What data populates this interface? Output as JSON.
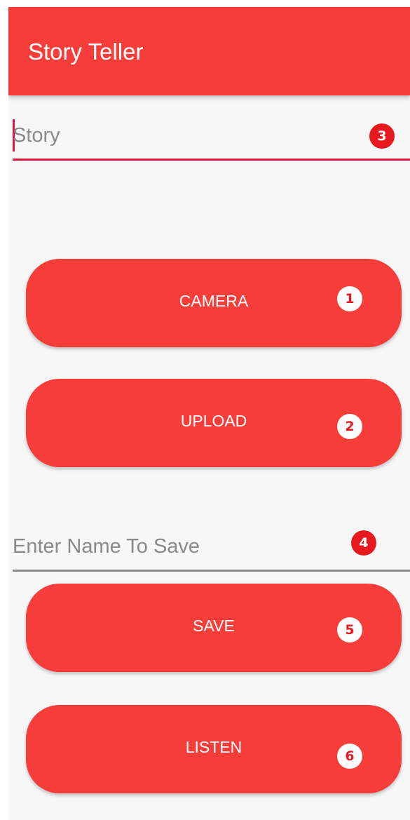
{
  "appbar": {
    "title": "Story Teller"
  },
  "story_field": {
    "placeholder": "Story",
    "badge": "3"
  },
  "buttons": [
    {
      "label": "CAMERA",
      "badge": "1"
    },
    {
      "label": "UPLOAD",
      "badge": "2"
    },
    {
      "label": "SAVE",
      "badge": "5"
    },
    {
      "label": "LISTEN",
      "badge": "6"
    }
  ],
  "name_field": {
    "placeholder": "Enter Name To Save",
    "badge": "4"
  },
  "colors": {
    "primary": "#f63d3a",
    "accent": "#e0143c",
    "background": "#f7f7f7"
  }
}
